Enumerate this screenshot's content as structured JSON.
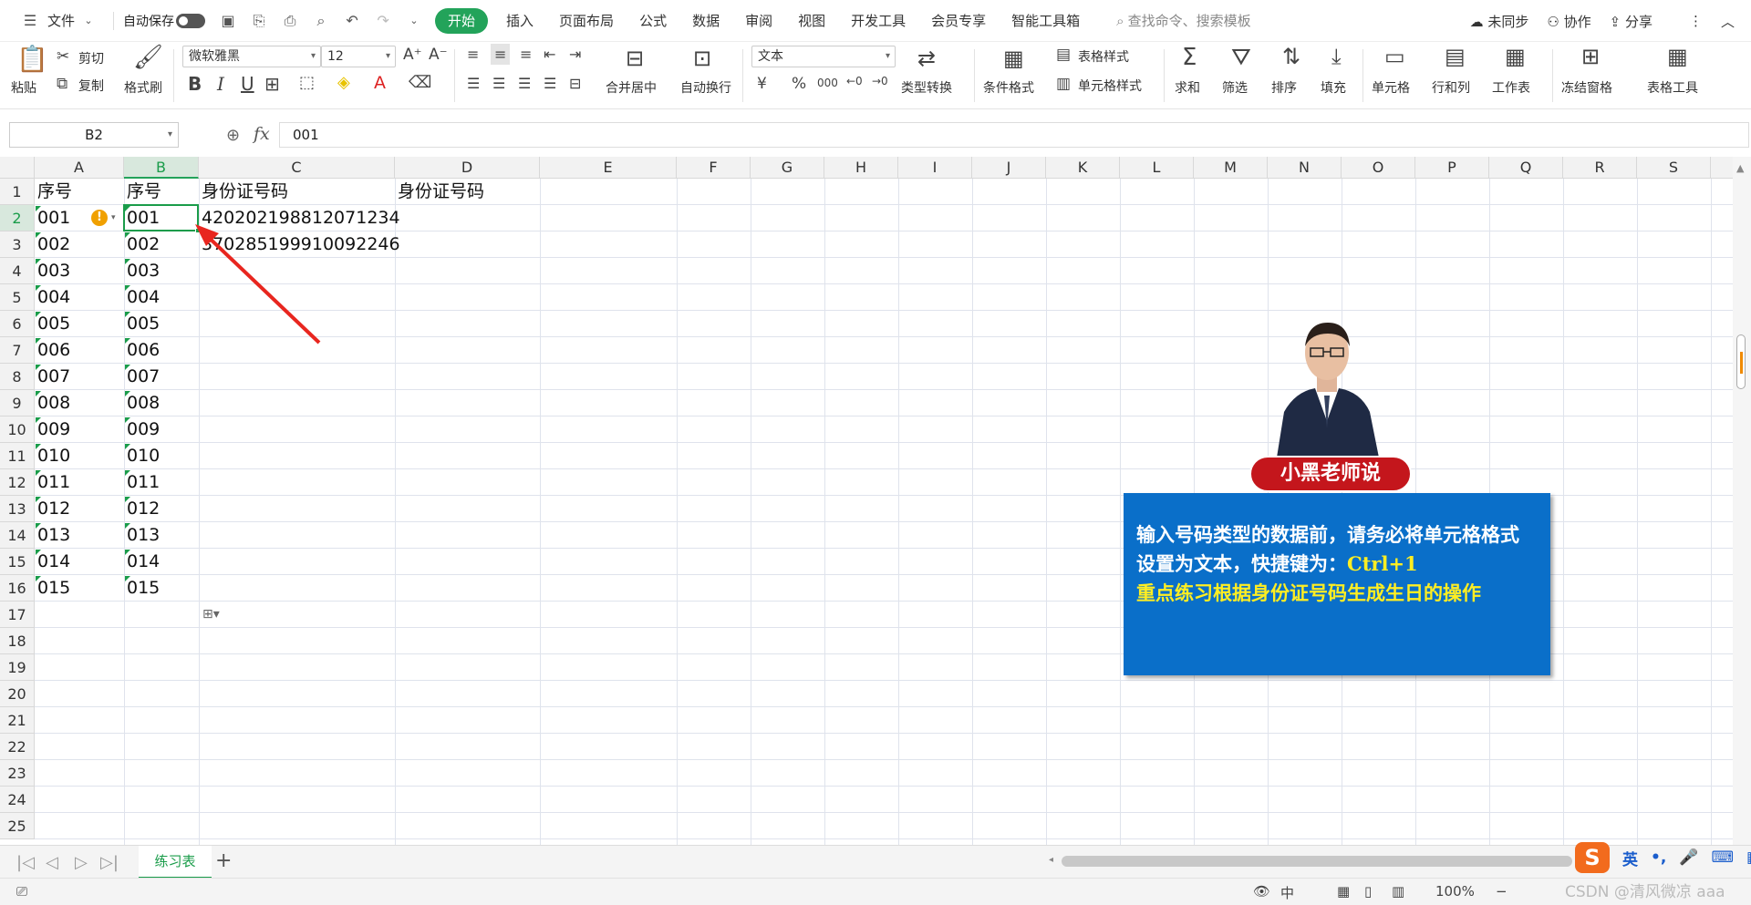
{
  "menubar": {
    "file": "文件",
    "autosave": "自动保存",
    "tabs": [
      "开始",
      "插入",
      "页面布局",
      "公式",
      "数据",
      "审阅",
      "视图",
      "开发工具",
      "会员专享",
      "智能工具箱"
    ],
    "search": "查找命令、搜索模板",
    "sync": "未同步",
    "collab": "协作",
    "share": "分享"
  },
  "ribbon": {
    "paste": "粘贴",
    "cut": "剪切",
    "copy": "复制",
    "format_painter": "格式刷",
    "font_name": "微软雅黑",
    "font_size": "12",
    "merge_center": "合并居中",
    "wrap_text": "自动换行",
    "number_format": "文本",
    "type_convert": "类型转换",
    "cond_format": "条件格式",
    "table_style": "表格样式",
    "cell_style": "单元格样式",
    "sum": "求和",
    "filter": "筛选",
    "sort": "排序",
    "fill": "填充",
    "cell": "单元格",
    "row_col": "行和列",
    "worksheet": "工作表",
    "freeze": "冻结窗格",
    "table_tools": "表格工具"
  },
  "formula_bar": {
    "name_box": "B2",
    "fx": "fx",
    "content": "001"
  },
  "columns": [
    "A",
    "B",
    "C",
    "D",
    "E",
    "F",
    "G",
    "H",
    "I",
    "J",
    "K",
    "L",
    "M",
    "N",
    "O",
    "P",
    "Q",
    "R",
    "S"
  ],
  "rows": [
    "1",
    "2",
    "3",
    "4",
    "5",
    "6",
    "7",
    "8",
    "9",
    "10",
    "11",
    "12",
    "13",
    "14",
    "15",
    "16",
    "17",
    "18",
    "19",
    "20",
    "21",
    "22",
    "23",
    "24",
    "25"
  ],
  "sheet": {
    "A": [
      "序号",
      "001",
      "002",
      "003",
      "004",
      "005",
      "006",
      "007",
      "008",
      "009",
      "010",
      "011",
      "012",
      "013",
      "014",
      "015"
    ],
    "B": [
      "序号",
      "001",
      "002",
      "003",
      "004",
      "005",
      "006",
      "007",
      "008",
      "009",
      "010",
      "011",
      "012",
      "013",
      "014",
      "015"
    ],
    "C": [
      "身份证号码",
      "420202198812071234",
      "370285199910092246"
    ],
    "D": [
      "身份证号码"
    ]
  },
  "warning_icon": "!",
  "sheet_tabs": [
    "练习表"
  ],
  "statusbar": {
    "input_mode": "中",
    "zoom": "100%"
  },
  "callout": {
    "badge": "小黑老师说",
    "line1": "输入号码类型的数据前，请务必将单元格格式",
    "line2_text": "设置为文本，快捷键为：",
    "line2_key": "Ctrl+1",
    "line3": "重点练习根据身份证号码生成生日的操作"
  },
  "ime": {
    "lang": "英"
  },
  "watermark": "CSDN @清风微凉 aaa",
  "colors": {
    "accent": "#23a35a",
    "callout_bg": "#0a6fc9",
    "badge_bg": "#c4161c",
    "arrow": "#e8261f",
    "highlight_text": "#ffee22"
  }
}
